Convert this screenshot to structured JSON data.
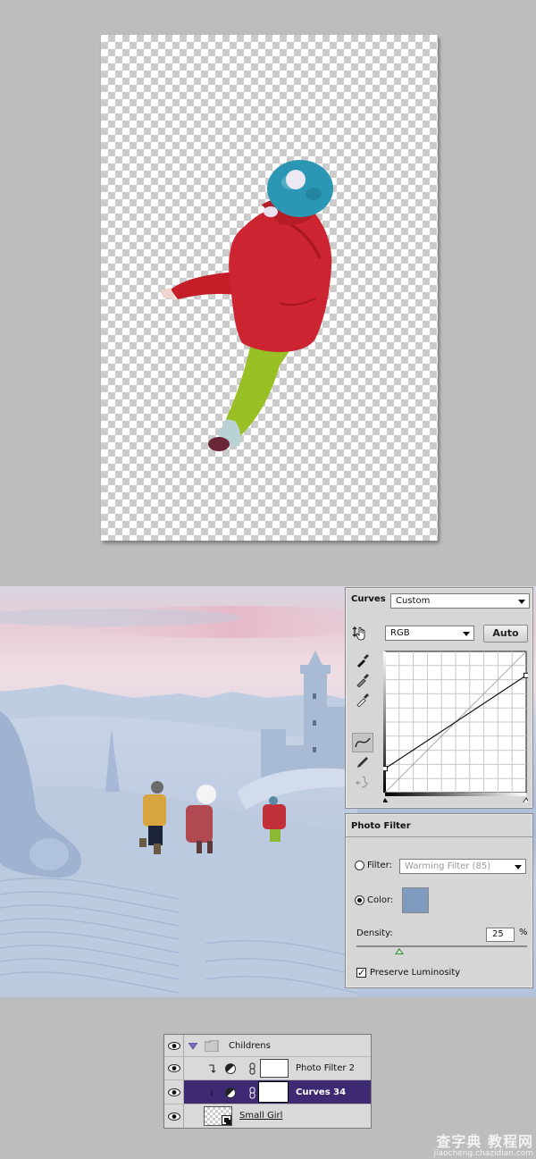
{
  "canvas_top": {
    "description": "Child cutout on transparent background",
    "subject": "child-in-red-jacket-back-view",
    "colors": {
      "jacket": "#c8202a",
      "pants": "#9cc22a",
      "hat": "#2a9ab8",
      "pompom": "#e8e6f2",
      "boot": "#6a2a3a"
    }
  },
  "scene": {
    "description": "Snowy fantasy landscape with castle and three children",
    "sky_colors": [
      "#d9d4df",
      "#efdde2",
      "#c8d2e4"
    ]
  },
  "curves_panel": {
    "title": "Curves",
    "preset": "Custom",
    "channel": "RGB",
    "auto_label": "Auto",
    "tools": [
      "hand-adjust-icon",
      "black-point-eyedropper-icon",
      "gray-point-eyedropper-icon",
      "white-point-eyedropper-icon",
      "curve-point-icon",
      "pencil-icon",
      "smooth-icon"
    ],
    "curve_points": [
      [
        0,
        0.17
      ],
      [
        1,
        0.83
      ]
    ],
    "grid_divisions": 10
  },
  "photo_filter_panel": {
    "title": "Photo Filter",
    "filter_label": "Filter:",
    "filter_value": "Warming Filter (85)",
    "filter_selected": false,
    "color_label": "Color:",
    "color_selected": true,
    "color_swatch": "#7f9cc0",
    "density_label": "Density:",
    "density_value": "25",
    "density_unit": "%",
    "density_fraction": 0.25,
    "preserve_luminosity_label": "Preserve Luminosity",
    "preserve_luminosity": true
  },
  "layers_panel": {
    "layers": [
      {
        "name": "Childrens",
        "type": "group",
        "expanded": true,
        "visible": true,
        "selected": false
      },
      {
        "name": "Photo Filter 2",
        "type": "adjustment",
        "clipped": true,
        "visible": true,
        "selected": false
      },
      {
        "name": "Curves 34",
        "type": "adjustment",
        "clipped": true,
        "visible": true,
        "selected": true
      },
      {
        "name": "Small Girl",
        "type": "smart-object",
        "visible": true,
        "selected": false
      }
    ],
    "selected_color": "#3d2a72"
  },
  "watermark": {
    "cn": "查字典 教程网",
    "url": "jiaocheng.chazidian.com"
  }
}
